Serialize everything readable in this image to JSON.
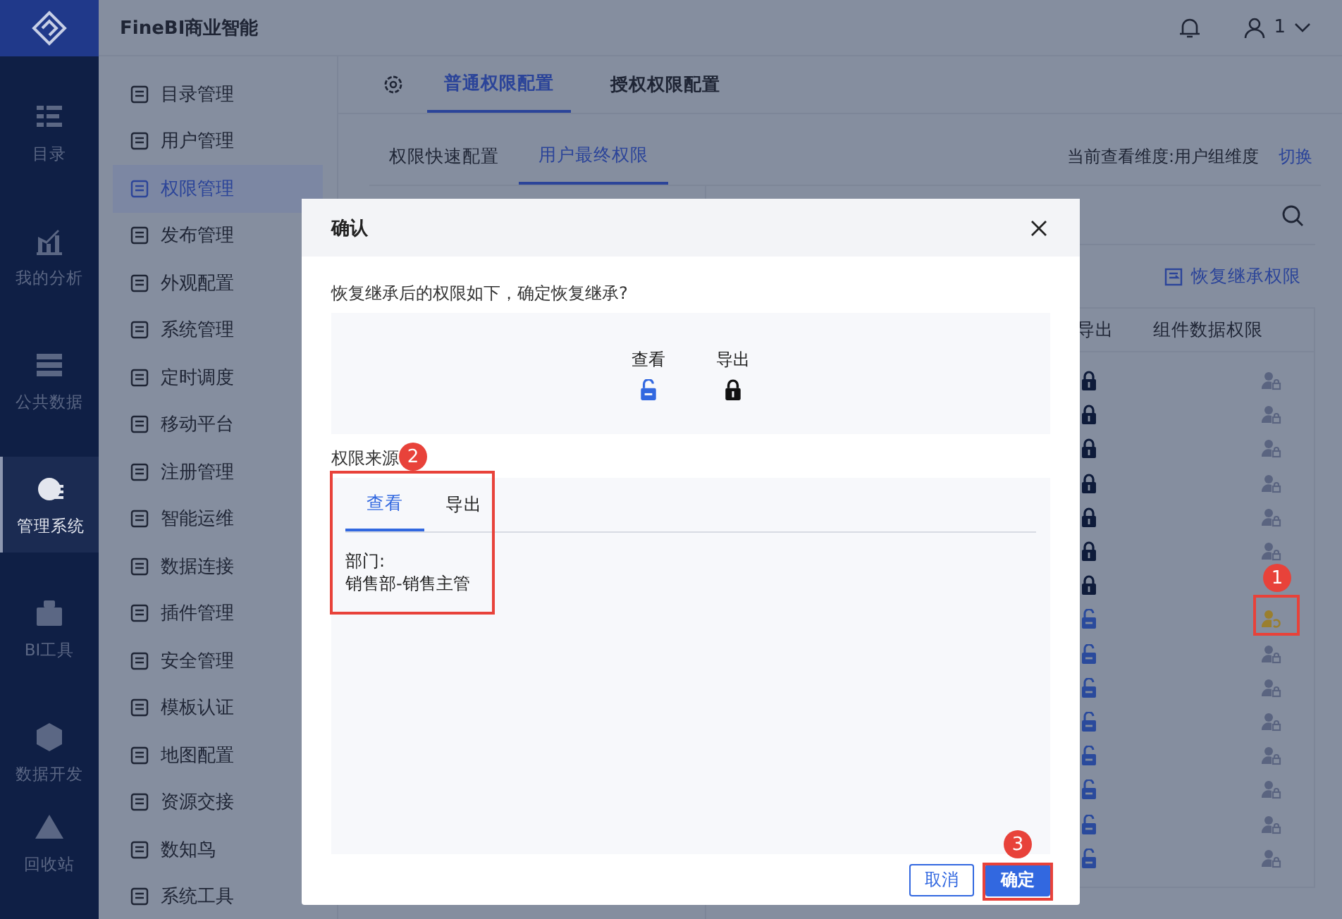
{
  "nav": [
    {
      "label": "目录",
      "selected": false
    },
    {
      "label": "我的分析",
      "selected": false
    },
    {
      "label": "公共数据",
      "selected": false
    },
    {
      "label": "管理系统",
      "selected": true
    },
    {
      "label": "BI工具",
      "selected": false
    },
    {
      "label": "数据开发",
      "selected": false
    },
    {
      "label": "回收站",
      "selected": false
    }
  ],
  "header": {
    "title": "FineBI商业智能",
    "user": "1"
  },
  "menu": [
    {
      "label": "目录管理",
      "selected": false
    },
    {
      "label": "用户管理",
      "selected": false
    },
    {
      "label": "权限管理",
      "selected": true
    },
    {
      "label": "发布管理",
      "selected": false
    },
    {
      "label": "外观配置",
      "selected": false
    },
    {
      "label": "系统管理",
      "selected": false
    },
    {
      "label": "定时调度",
      "selected": false
    },
    {
      "label": "移动平台",
      "selected": false
    },
    {
      "label": "注册管理",
      "selected": false
    },
    {
      "label": "智能运维",
      "selected": false
    },
    {
      "label": "数据连接",
      "selected": false
    },
    {
      "label": "插件管理",
      "selected": false
    },
    {
      "label": "安全管理",
      "selected": false
    },
    {
      "label": "模板认证",
      "selected": false
    },
    {
      "label": "地图配置",
      "selected": false
    },
    {
      "label": "资源交接",
      "selected": false
    },
    {
      "label": "数知鸟",
      "selected": false
    },
    {
      "label": "系统工具",
      "selected": false
    }
  ],
  "tabs": [
    {
      "label": "普通权限配置",
      "selected": true
    },
    {
      "label": "授权权限配置",
      "selected": false
    }
  ],
  "subtabs": [
    {
      "label": "权限快速配置",
      "selected": false
    },
    {
      "label": "用户最终权限",
      "selected": true
    }
  ],
  "dimension": {
    "label": "当前查看维度:用户组维度",
    "action": "切换"
  },
  "restore_link": "恢复继承权限",
  "table": {
    "columns": [
      "导出",
      "组件数据权限"
    ],
    "rows": [
      {
        "export_allowed": false,
        "kind": "custom"
      },
      {
        "export_allowed": false,
        "kind": "custom"
      },
      {
        "export_allowed": false,
        "kind": "custom"
      },
      {
        "export_allowed": false,
        "kind": "custom"
      },
      {
        "export_allowed": false,
        "kind": "custom"
      },
      {
        "export_allowed": false,
        "kind": "custom"
      },
      {
        "export_allowed": false
      },
      {
        "export_allowed": true,
        "kind": "inherited"
      },
      {
        "export_allowed": true,
        "kind": "custom"
      },
      {
        "export_allowed": true,
        "kind": "custom"
      },
      {
        "export_allowed": true,
        "kind": "custom"
      },
      {
        "export_allowed": true,
        "kind": "custom"
      },
      {
        "export_allowed": true,
        "kind": "custom"
      },
      {
        "export_allowed": true,
        "kind": "custom"
      },
      {
        "export_allowed": true,
        "kind": "custom"
      }
    ]
  },
  "dialog": {
    "title": "确认",
    "message": "恢复继承后的权限如下，确定恢复继承?",
    "permissions": [
      {
        "label": "查看",
        "allowed": true
      },
      {
        "label": "导出",
        "allowed": false
      }
    ],
    "source_label": "权限来源",
    "source_tabs": [
      {
        "label": "查看",
        "selected": true
      },
      {
        "label": "导出",
        "selected": false
      }
    ],
    "source_lines": [
      "部门:",
      "销售部-销售主管"
    ],
    "buttons": [
      {
        "label": "取消",
        "kind": "secondary"
      },
      {
        "label": "确定",
        "kind": "primary"
      }
    ]
  },
  "callouts": [
    "1",
    "2",
    "3"
  ]
}
